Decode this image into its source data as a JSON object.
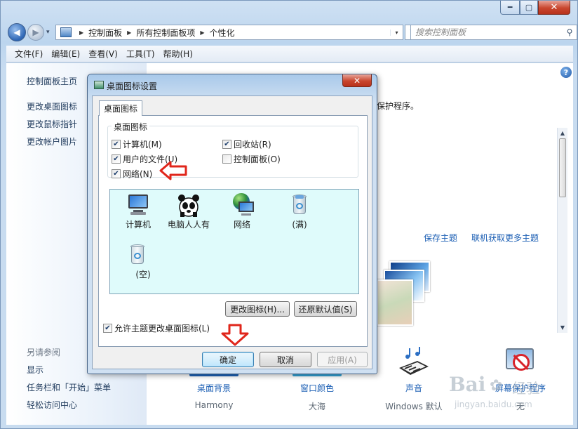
{
  "window": {
    "caption_min": "━",
    "caption_max": "▢",
    "caption_close": "✕"
  },
  "nav": {
    "back_glyph": "◀",
    "forward_glyph": "▶",
    "drop_glyph": "▾",
    "breadcrumb": [
      "控制面板",
      "所有控制面板项",
      "个性化"
    ],
    "refresh_glyph": "↻",
    "search_placeholder": "搜索控制面板"
  },
  "menu": [
    "文件(F)",
    "编辑(E)",
    "查看(V)",
    "工具(T)",
    "帮助(H)"
  ],
  "left_pane": {
    "home": "控制面板主页",
    "links": [
      "更改桌面图标",
      "更改鼠标指针",
      "更改帐户图片"
    ],
    "see_also_header": "另请参阅",
    "see_also": [
      "显示",
      "任务栏和「开始」菜单",
      "轻松访问中心"
    ]
  },
  "help_glyph": "?",
  "main": {
    "screensaver_tail": "保护程序。",
    "save_theme": "保存主题",
    "more_themes": "联机获取更多主题",
    "bottom": [
      {
        "label": "桌面背景",
        "sub": "Harmony"
      },
      {
        "label": "窗口颜色",
        "sub": "大海"
      },
      {
        "label": "声音",
        "sub": "Windows 默认"
      },
      {
        "label": "屏幕保护程序",
        "sub": "无"
      }
    ]
  },
  "dialog": {
    "title": "桌面图标设置",
    "close_glyph": "✕",
    "tab": "桌面图标",
    "group_title": "桌面图标",
    "checkboxes": [
      {
        "label": "计算机(M)",
        "checked": true
      },
      {
        "label": "回收站(R)",
        "checked": true
      },
      {
        "label": "用户的文件(U)",
        "checked": true
      },
      {
        "label": "控制面板(O)",
        "checked": false
      },
      {
        "label": "网络(N)",
        "checked": true
      }
    ],
    "check_glyph": "✔",
    "preview_icons": [
      {
        "label": "计算机",
        "icon": "computer-icon"
      },
      {
        "label": "电脑人人有",
        "icon": "user-files-icon"
      },
      {
        "label": "网络",
        "icon": "network-icon"
      },
      {
        "label": "(满)",
        "icon": "recycle-bin-full-icon"
      },
      {
        "label": "(空)",
        "icon": "recycle-bin-empty-icon"
      }
    ],
    "change_icon": "更改图标(H)...",
    "restore_default": "还原默认值(S)",
    "allow_themes": "允许主题更改桌面图标(L)",
    "ok": "确定",
    "cancel": "取消",
    "apply": "应用(A)"
  },
  "watermark": {
    "brand": "Bai",
    "brand_suffix": "经验",
    "url": "jingyan.baidu.com"
  },
  "colors": {
    "accent_link": "#1c5fb4",
    "annotation_red": "#e0261b",
    "preview_bg": "#dffbfb"
  }
}
